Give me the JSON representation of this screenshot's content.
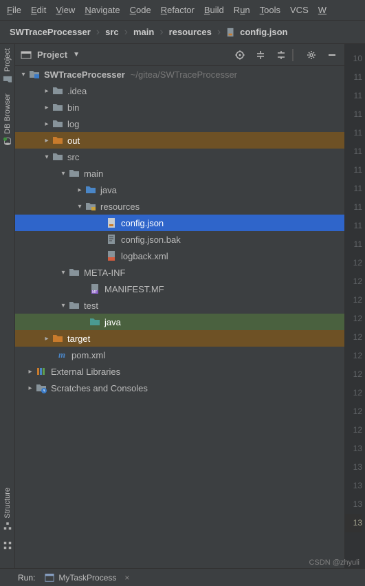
{
  "menu": {
    "file": "File",
    "edit": "Edit",
    "view": "View",
    "navigate": "Navigate",
    "code": "Code",
    "refactor": "Refactor",
    "build": "Build",
    "run": "Run",
    "tools": "Tools",
    "vcs": "VCS",
    "window": "W"
  },
  "crumbs": {
    "project": "SWTraceProcesser",
    "c1": "src",
    "c2": "main",
    "c3": "resources",
    "c4": "config.json"
  },
  "panel": {
    "title": "Project"
  },
  "tree": {
    "root": "SWTraceProcesser",
    "root_path": "~/gitea/SWTraceProcesser",
    "idea": ".idea",
    "bin": "bin",
    "log": "log",
    "out": "out",
    "src": "src",
    "main": "main",
    "java_main": "java",
    "resources": "resources",
    "config": "config.json",
    "config_bak": "config.json.bak",
    "logback": "logback.xml",
    "metainf": "META-INF",
    "manifest": "MANIFEST.MF",
    "test": "test",
    "java_test": "java",
    "target": "target",
    "pom": "pom.xml",
    "ext": "External Libraries",
    "scratches": "Scratches and Consoles"
  },
  "gutter": [
    "10",
    "11",
    "11",
    "11",
    "11",
    "11",
    "11",
    "11",
    "11",
    "11",
    "11",
    "12",
    "12",
    "12",
    "12",
    "12",
    "12",
    "12",
    "12",
    "12",
    "12",
    "13",
    "13",
    "13",
    "13",
    "13"
  ],
  "bottom": {
    "run": "Run:",
    "task": "MyTaskProcess"
  },
  "watermark": "CSDN @zhyuli"
}
